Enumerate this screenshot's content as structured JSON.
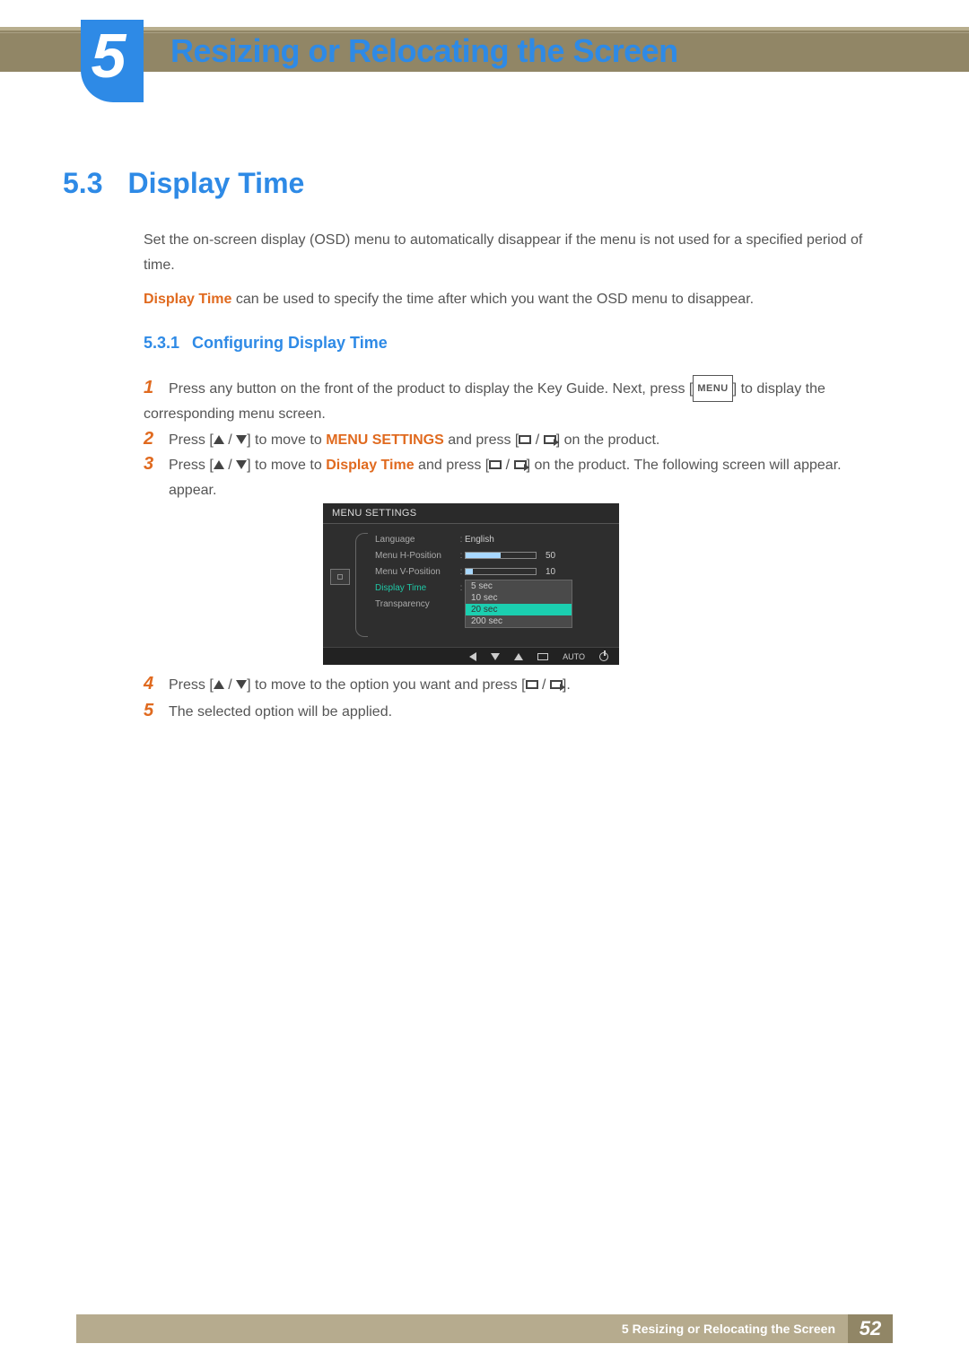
{
  "chapter": {
    "number": "5",
    "title": "Resizing or Relocating the Screen"
  },
  "section": {
    "number": "5.3",
    "title": "Display Time"
  },
  "intro": {
    "p1": "Set the on-screen display (OSD) menu to automatically disappear if the menu is not used for a specified period of time.",
    "p2_hl": "Display Time",
    "p2_rest": " can be used to specify the time after which you want the OSD menu to disappear."
  },
  "subsection": {
    "number": "5.3.1",
    "title": "Configuring Display Time"
  },
  "steps": {
    "s1": {
      "n": "1",
      "a": "Press any button on the front of the product to display the Key Guide. Next, press [",
      "menu": "MENU",
      "b": "] to display the corresponding menu screen."
    },
    "s2": {
      "n": "2",
      "a": "Press [",
      "b": "] to move to ",
      "hl": "MENU SETTINGS",
      "c": " and press [",
      "d": "] on the product."
    },
    "s3": {
      "n": "3",
      "a": "Press [",
      "b": "] to move to ",
      "hl": "Display Time",
      "c": " and press [",
      "d": "] on the product. The following screen will appear."
    },
    "s4": {
      "n": "4",
      "a": "Press [",
      "b": "] to move to the option you want and press [",
      "c": "]."
    },
    "s5": {
      "n": "5",
      "a": "The selected option will be applied."
    }
  },
  "osd": {
    "title": "MENU SETTINGS",
    "rows": [
      {
        "label": "Language",
        "value": "English",
        "type": "text"
      },
      {
        "label": "Menu H-Position",
        "value": "50",
        "type": "slider",
        "fill": 50
      },
      {
        "label": "Menu V-Position",
        "value": "10",
        "type": "slider",
        "fill": 10
      },
      {
        "label": "Display Time",
        "type": "dropdown",
        "active": true
      },
      {
        "label": "Transparency",
        "type": "text",
        "value": ""
      }
    ],
    "dropdown": [
      "5 sec",
      "10 sec",
      "20 sec",
      "200 sec"
    ],
    "dropdown_selected": 2,
    "auto_label": "AUTO"
  },
  "footer": {
    "chapter": "5",
    "title": "Resizing or Relocating the Screen",
    "page": "52"
  }
}
